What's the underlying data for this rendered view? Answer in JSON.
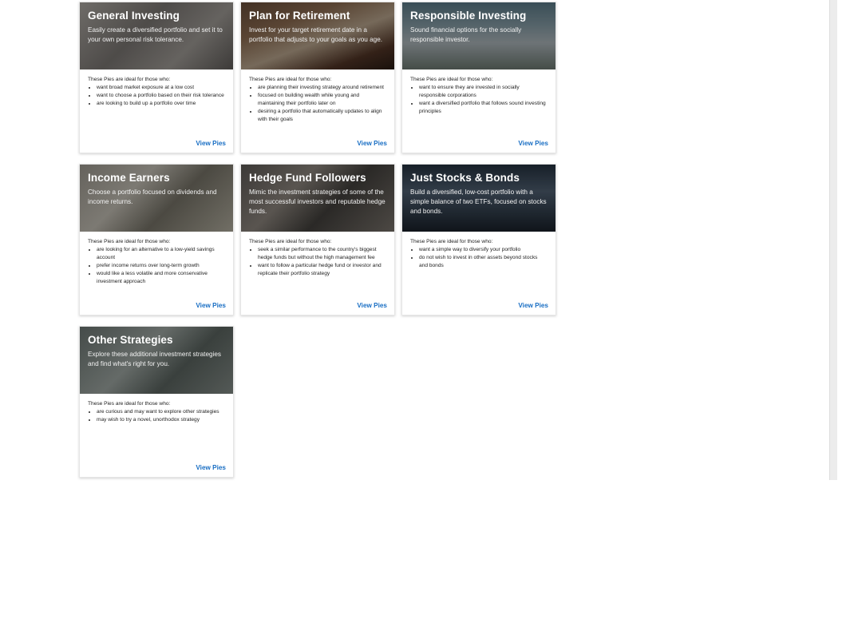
{
  "cards": [
    {
      "title": "General Investing",
      "description": "Easily create a diversified portfolio and set it to your own personal risk tolerance.",
      "intro": "These Pies are ideal for those who:",
      "bullets": [
        "want broad market exposure at a low cost",
        "want to choose a portfolio based on their risk tolerance",
        "are looking to build up a portfolio over time"
      ],
      "link": "View Pies"
    },
    {
      "title": "Plan for Retirement",
      "description": "Invest for your target retirement date in a portfolio that adjusts to your goals as you age.",
      "intro": "These Pies are ideal for those who:",
      "bullets": [
        "are planning their investing strategy around retirement",
        "focused on building wealth while young and maintaining their portfolio later on",
        "desiring a portfolio that automatically updates to align with their goals"
      ],
      "link": "View Pies"
    },
    {
      "title": "Responsible Investing",
      "description": "Sound financial options for the socially responsible investor.",
      "intro": "These Pies are ideal for those who:",
      "bullets": [
        "want to ensure they are invested in socially responsible corporations",
        "want a diversified portfolio that follows sound investing principles"
      ],
      "link": "View Pies"
    },
    {
      "title": "Income Earners",
      "description": "Choose a portfolio focused on dividends and income returns.",
      "intro": "These Pies are ideal for those who:",
      "bullets": [
        "are looking for an alternative to a low-yield savings account",
        "prefer income returns over long-term growth",
        "would like a less volatile and more conservative investment approach"
      ],
      "link": "View Pies"
    },
    {
      "title": "Hedge Fund Followers",
      "description": "Mimic the investment strategies of some of the most successful investors and reputable hedge funds.",
      "intro": "These Pies are ideal for those who:",
      "bullets": [
        "seek a similar performance to the country's biggest hedge funds but without the high management fee",
        "want to follow a particular hedge fund or investor and replicate their portfolio strategy"
      ],
      "link": "View Pies"
    },
    {
      "title": "Just Stocks & Bonds",
      "description": "Build a diversified, low-cost portfolio with a simple balance of two ETFs, focused on stocks and bonds.",
      "intro": "These Pies are ideal for those who:",
      "bullets": [
        "want a simple way to diversify your portfolio",
        "do not wish to invest in other assets beyond stocks and bonds"
      ],
      "link": "View Pies"
    },
    {
      "title": "Other Strategies",
      "description": "Explore these additional investment strategies and find what's right for you.",
      "intro": "These Pies are ideal for those who:",
      "bullets": [
        "are curious and may want to explore other strategies",
        "may wish to try a novel, unorthodox strategy"
      ],
      "link": "View Pies"
    }
  ]
}
